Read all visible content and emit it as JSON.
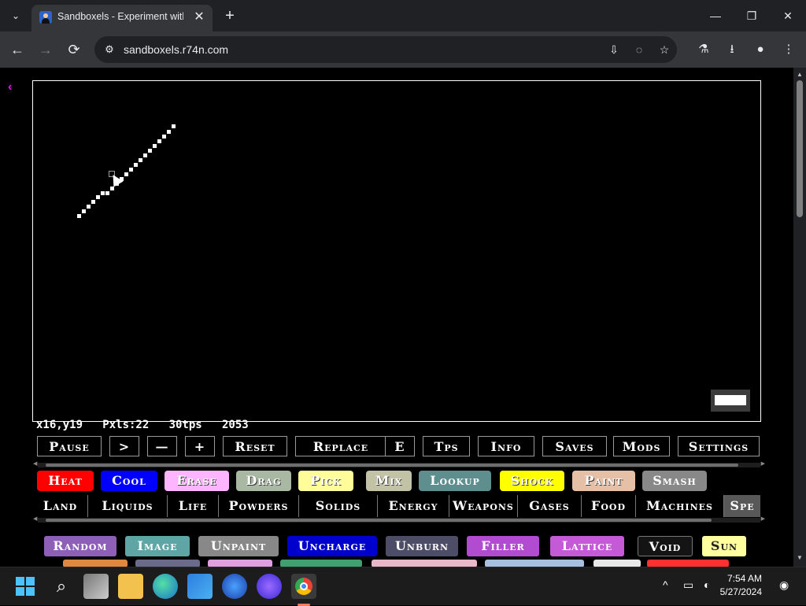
{
  "browser": {
    "tab_title": "Sandboxels - Experiment with P",
    "tab_close": "✕",
    "new_tab": "+",
    "tab_list": "⌄",
    "window_minimize": "—",
    "window_maximize": "❐",
    "window_close": "✕",
    "nav_back": "←",
    "nav_forward": "→",
    "reload": "⟳",
    "site_info": "⚙",
    "url": "sandboxels.r74n.com",
    "icons": {
      "install": "⇩",
      "hide": "◌",
      "bookmark": "☆",
      "labs": "⚗",
      "downloads": "⭳",
      "profile": "●",
      "menu": "⋮"
    }
  },
  "game": {
    "back": "‹",
    "stats": "x16,y19   Pxls:22   30tps   2053",
    "controls": [
      "Pause",
      ">",
      "—",
      "+",
      "Reset",
      "Replace",
      "E",
      "Tps",
      "Info",
      "Saves",
      "Mods",
      "Settings"
    ],
    "tools": [
      {
        "label": "Heat",
        "color": "#ff0000"
      },
      {
        "label": "Cool",
        "color": "#0000ff"
      },
      {
        "label": "Erase",
        "color": "#fdb5ff"
      },
      {
        "label": "Drag",
        "color": "#a9b8a3"
      },
      {
        "label": "Pick",
        "color": "#fffd9a"
      },
      {
        "label": "Mix",
        "color": "#c2c2a6"
      },
      {
        "label": "Lookup",
        "color": "#5f8e8e"
      },
      {
        "label": "Shock",
        "color": "#ffff00"
      },
      {
        "label": "Paint",
        "color": "#e6c0a6"
      },
      {
        "label": "Smash",
        "color": "#888888"
      }
    ],
    "categories": [
      "Land",
      "Liquids",
      "Life",
      "Powders",
      "Solids",
      "Energy",
      "Weapons",
      "Gases",
      "Food",
      "Machines",
      "Spe"
    ],
    "active_category": "Spe",
    "elements": [
      {
        "label": "Random",
        "color": "#8e5fb7"
      },
      {
        "label": "Image",
        "color": "#5fa5a5"
      },
      {
        "label": "Unpaint",
        "color": "#888888"
      },
      {
        "label": "Uncharge",
        "color": "#0000cc"
      },
      {
        "label": "Unburn",
        "color": "#4d4d67"
      },
      {
        "label": "Filler",
        "color": "#b14cd0"
      },
      {
        "label": "Lattice",
        "color": "#c55ad7"
      },
      {
        "label": "Void",
        "color": "#141414"
      },
      {
        "label": "Sun",
        "color": "#ffffa0"
      }
    ],
    "peek_elements": [
      {
        "color": "#e08840"
      },
      {
        "color": "#6a6a8a"
      },
      {
        "color": "#e0a0e0"
      },
      {
        "color": "#40a070"
      },
      {
        "color": "#e8b8c8"
      },
      {
        "color": "#a8c0e0"
      },
      {
        "color": "#e8e8e8"
      },
      {
        "color": "#ff3030"
      }
    ]
  },
  "taskbar": {
    "time": "7:54 AM",
    "date": "5/27/2024",
    "tray_chevron": "^",
    "search_icon": "⌕"
  }
}
